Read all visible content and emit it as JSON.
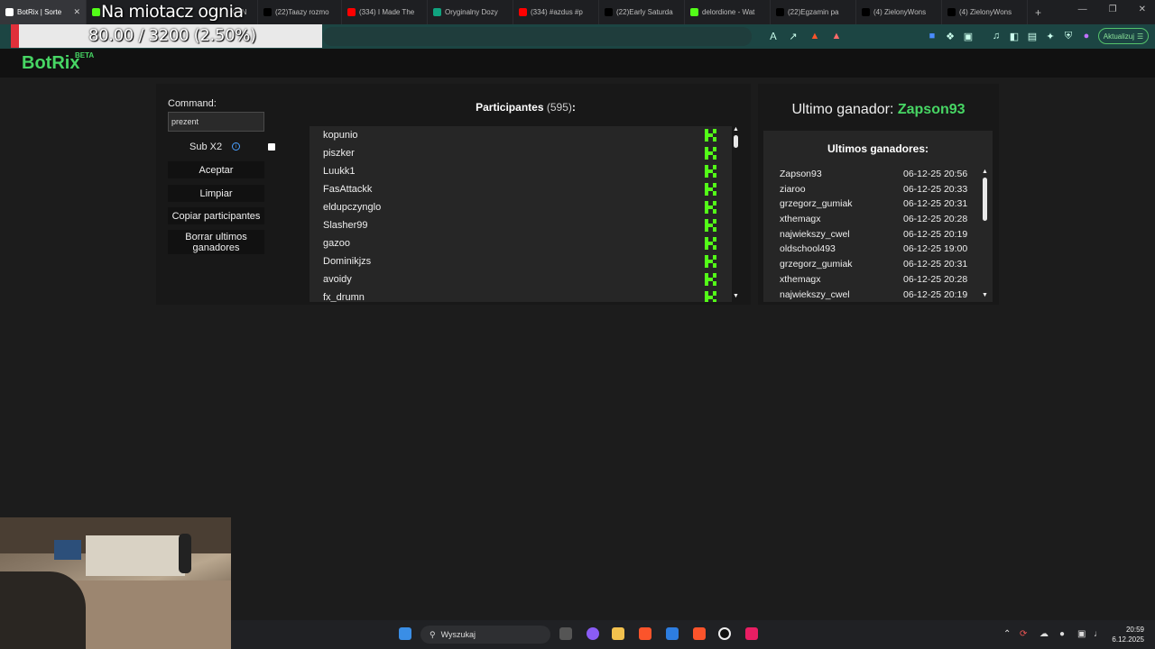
{
  "browser": {
    "tabs": [
      {
        "label": "BotRix | Sorte",
        "icon": "botrix-favicon",
        "active": true,
        "color": "#ffffff"
      },
      {
        "label": "X: \"N",
        "icon": "kick-favicon",
        "color": "#53fc18"
      },
      {
        "label": "(22)Taazy rozmo",
        "icon": "tiktok-favicon",
        "color": "#000000"
      },
      {
        "label": "(334) I Made The",
        "icon": "youtube-favicon",
        "color": "#ff0000"
      },
      {
        "label": "Oryginalny Dozy",
        "icon": "chatgpt-favicon",
        "color": "#10a37f"
      },
      {
        "label": "(334) #azdus #p",
        "icon": "youtube-favicon",
        "color": "#ff0000"
      },
      {
        "label": "(22)Early Saturda",
        "icon": "tiktok-favicon",
        "color": "#000000"
      },
      {
        "label": "delordione - Wat",
        "icon": "kick-favicon",
        "color": "#53fc18"
      },
      {
        "label": "(22)Egzamin pa",
        "icon": "tiktok-favicon",
        "color": "#000000"
      },
      {
        "label": "(4) ZielonyWons",
        "icon": "x-favicon",
        "color": "#000000"
      },
      {
        "label": "(4) ZielonyWons",
        "icon": "x-favicon",
        "color": "#000000"
      }
    ],
    "update_label": "Aktualizuj"
  },
  "overlay": {
    "title": "Na miotacz ognia",
    "progress_text": "80.00 / 3200 (2.50%)",
    "progress_fraction": 0.025,
    "fill_color": "#e0303a"
  },
  "app": {
    "logo": "BotRix",
    "logo_badge": "BETA",
    "brand_color": "#47d664"
  },
  "controls": {
    "command_label": "Command:",
    "command_value": "prezent",
    "sub_label": "Sub X2",
    "sub_checked": false,
    "accept_label": "Aceptar",
    "clear_label": "Limpiar",
    "copy_label": "Copiar participantes",
    "delete_label": "Borrar ultimos ganadores"
  },
  "participants": {
    "title": "Participantes",
    "count": "(595)",
    "suffix": ":",
    "items": [
      "kopunio",
      "piszker",
      "Luukk1",
      "FasAttackk",
      "eldupczynglo",
      "Slasher99",
      "gazoo",
      "Dominikjzs",
      "avoidy",
      "fx_drumn"
    ]
  },
  "winners": {
    "last_label": "Ultimo ganador:",
    "last_name": "Zapson93",
    "list_title": "Ultimos ganadores:",
    "items": [
      {
        "name": "Zapson93",
        "time": "06-12-25 20:56"
      },
      {
        "name": "ziaroo",
        "time": "06-12-25 20:33"
      },
      {
        "name": "grzegorz_gumiak",
        "time": "06-12-25 20:31"
      },
      {
        "name": "xthemagx",
        "time": "06-12-25 20:28"
      },
      {
        "name": "najwiekszy_cwel",
        "time": "06-12-25 20:19"
      },
      {
        "name": "oldschool493",
        "time": "06-12-25 19:00"
      },
      {
        "name": "grzegorz_gumiak",
        "time": "06-12-25 20:31"
      },
      {
        "name": "xthemagx",
        "time": "06-12-25 20:28"
      },
      {
        "name": "najwiekszy_cwel",
        "time": "06-12-25 20:19"
      }
    ]
  },
  "taskbar": {
    "search_placeholder": "Wyszukaj",
    "time": "20:59",
    "date": "6.12.2025"
  }
}
